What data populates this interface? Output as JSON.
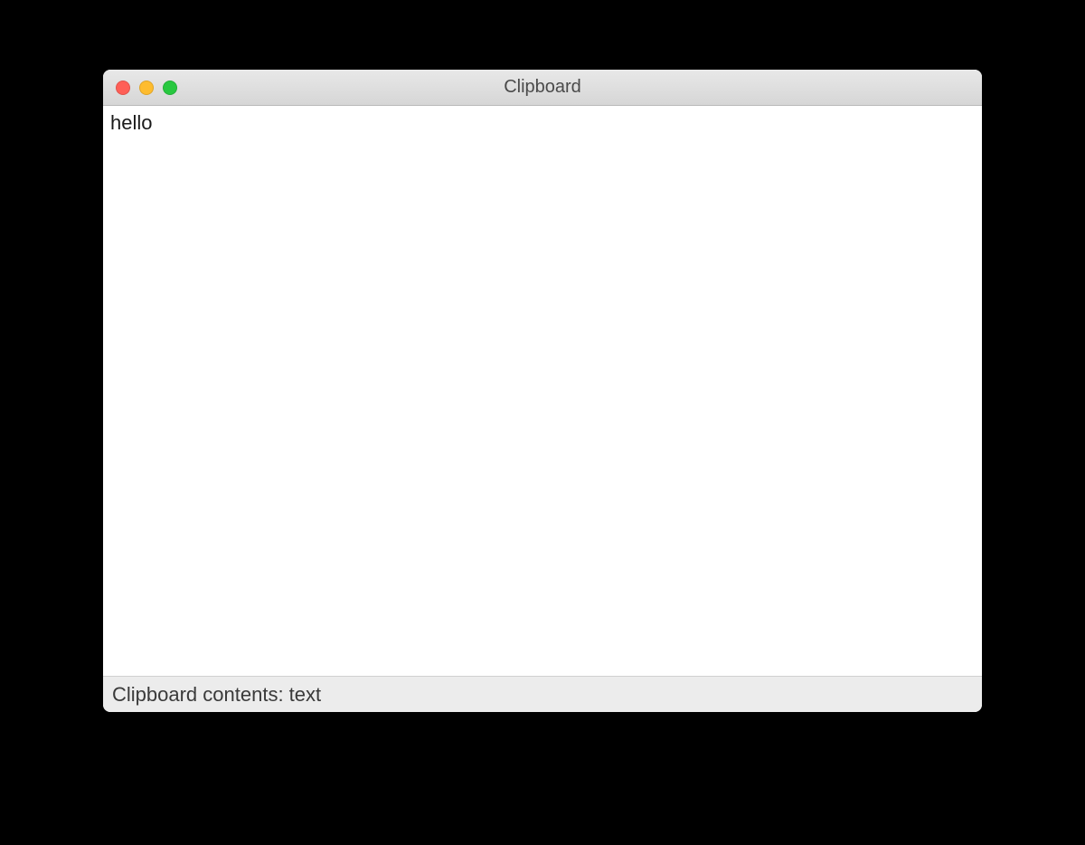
{
  "window": {
    "title": "Clipboard"
  },
  "content": {
    "text": "hello"
  },
  "statusbar": {
    "text": "Clipboard contents: text"
  }
}
